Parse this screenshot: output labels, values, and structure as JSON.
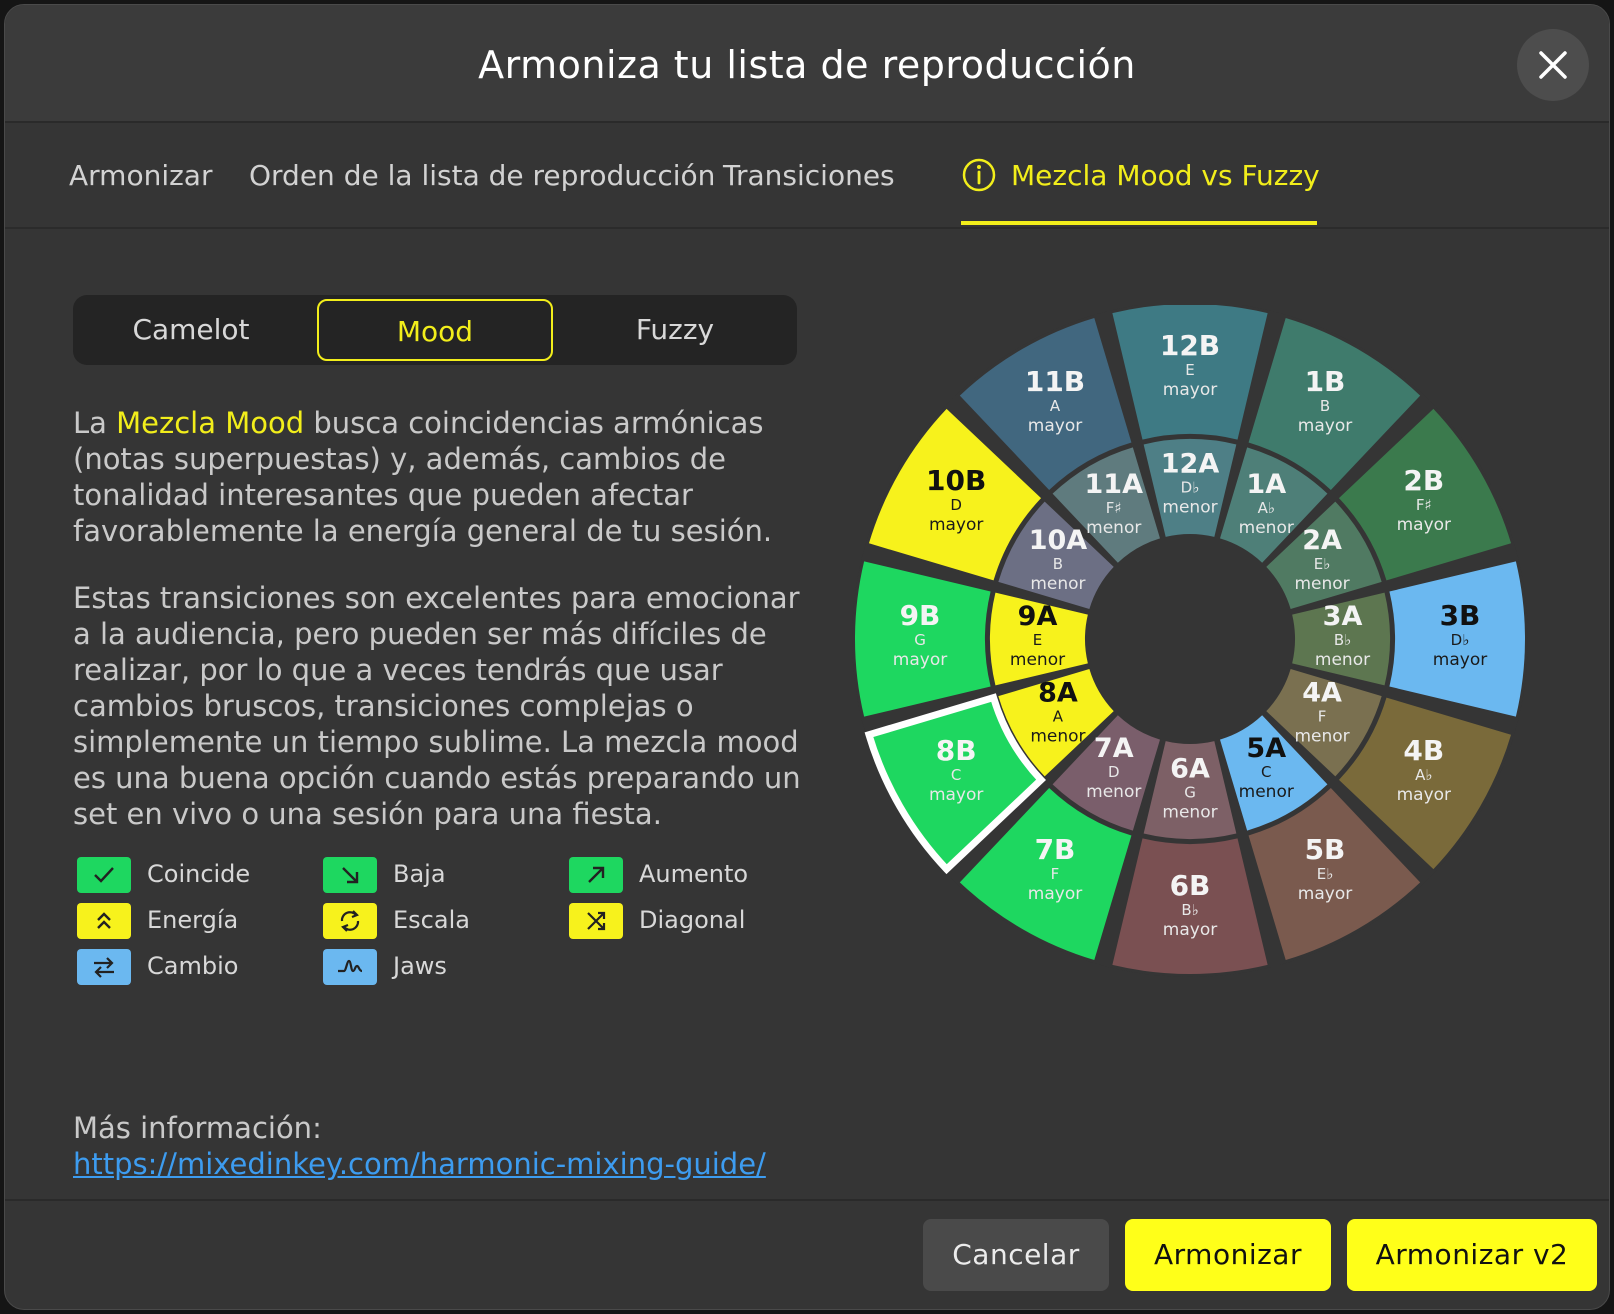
{
  "dialog": {
    "title": "Armoniza tu lista de reproducción"
  },
  "tabs": [
    {
      "label": "Armonizar"
    },
    {
      "label": "Orden de la lista de reproducción"
    },
    {
      "label": "Transiciones"
    },
    {
      "label": "Mezcla Mood vs Fuzzy"
    }
  ],
  "segmented": {
    "options": [
      "Camelot",
      "Mood",
      "Fuzzy"
    ],
    "selected": "Mood"
  },
  "description": {
    "p1_prefix": "La ",
    "p1_highlight": "Mezcla Mood",
    "p1_rest": " busca coincidencias armónicas (notas superpuestas) y, además, cambios de tonalidad interesantes que pueden afectar favorablemente la energía general de tu sesión.",
    "p2": "Estas transiciones son excelentes para emocionar a la audiencia, pero pueden ser más difíciles de realizar, por lo que a veces tendrás que usar cambios bruscos, transiciones complejas o simplemente un tiempo sublime. La mezcla mood es una buena opción cuando estás preparando un set en vivo o una sesión para una fiesta."
  },
  "legend": [
    {
      "label": "Coincide",
      "icon": "check-icon",
      "color": "#1ed760"
    },
    {
      "label": "Baja",
      "icon": "arrow-down-right-icon",
      "color": "#1ed760"
    },
    {
      "label": "Aumento",
      "icon": "arrow-up-right-icon",
      "color": "#1ed760"
    },
    {
      "label": "Energía",
      "icon": "double-chevron-up-icon",
      "color": "#f7f21c"
    },
    {
      "label": "Escala",
      "icon": "cycle-icon",
      "color": "#f7f21c"
    },
    {
      "label": "Diagonal",
      "icon": "shuffle-icon",
      "color": "#f7f21c"
    },
    {
      "label": "Cambio",
      "icon": "swap-arrows-icon",
      "color": "#6bb8f0"
    },
    {
      "label": "Jaws",
      "icon": "wave-icon",
      "color": "#6bb8f0"
    }
  ],
  "more_info": {
    "label": "Más información:",
    "url": "https://mixedinkey.com/harmonic-mixing-guide/"
  },
  "buttons": {
    "cancel": "Cancelar",
    "harmonize": "Armonizar",
    "harmonize_v2": "Armonizar v2"
  },
  "camelot_wheel": {
    "selected_key": "8B",
    "outer": [
      {
        "code": "12B",
        "note": "E",
        "mode": "mayor",
        "color": "#3e7a84"
      },
      {
        "code": "1B",
        "note": "B",
        "mode": "mayor",
        "color": "#3f7b6c"
      },
      {
        "code": "2B",
        "note": "F♯",
        "mode": "mayor",
        "color": "#3b7a4d"
      },
      {
        "code": "3B",
        "note": "D♭",
        "mode": "mayor",
        "color": "#6bb8f0"
      },
      {
        "code": "4B",
        "note": "A♭",
        "mode": "mayor",
        "color": "#7a6a3a"
      },
      {
        "code": "5B",
        "note": "E♭",
        "mode": "mayor",
        "color": "#7a5a4e"
      },
      {
        "code": "6B",
        "note": "B♭",
        "mode": "mayor",
        "color": "#7a5052"
      },
      {
        "code": "7B",
        "note": "F",
        "mode": "mayor",
        "color": "#1ed760"
      },
      {
        "code": "8B",
        "note": "C",
        "mode": "mayor",
        "color": "#1ed760"
      },
      {
        "code": "9B",
        "note": "G",
        "mode": "mayor",
        "color": "#1ed760"
      },
      {
        "code": "10B",
        "note": "D",
        "mode": "mayor",
        "color": "#f7f21c"
      },
      {
        "code": "11B",
        "note": "A",
        "mode": "mayor",
        "color": "#41677f"
      }
    ],
    "inner": [
      {
        "code": "12A",
        "note": "D♭",
        "mode": "menor",
        "color": "#4e7f86"
      },
      {
        "code": "1A",
        "note": "A♭",
        "mode": "menor",
        "color": "#4e7f78"
      },
      {
        "code": "2A",
        "note": "E♭",
        "mode": "menor",
        "color": "#507a62"
      },
      {
        "code": "3A",
        "note": "B♭",
        "mode": "menor",
        "color": "#5d7650"
      },
      {
        "code": "4A",
        "note": "F",
        "mode": "menor",
        "color": "#7a7050"
      },
      {
        "code": "5A",
        "note": "C",
        "mode": "menor",
        "color": "#6bb8f0"
      },
      {
        "code": "6A",
        "note": "G",
        "mode": "menor",
        "color": "#7d6066"
      },
      {
        "code": "7A",
        "note": "D",
        "mode": "menor",
        "color": "#7a5e6b"
      },
      {
        "code": "8A",
        "note": "A",
        "mode": "menor",
        "color": "#f7f21c"
      },
      {
        "code": "9A",
        "note": "E",
        "mode": "menor",
        "color": "#f7f21c"
      },
      {
        "code": "10A",
        "note": "B",
        "mode": "menor",
        "color": "#6c6f84"
      },
      {
        "code": "11A",
        "note": "F♯",
        "mode": "menor",
        "color": "#5f7b7e"
      }
    ]
  }
}
